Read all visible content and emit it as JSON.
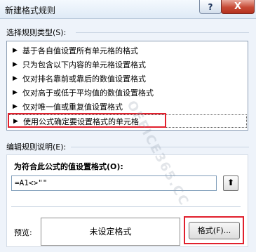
{
  "window": {
    "title": "新建格式规则",
    "help": "?",
    "close": "X"
  },
  "select_type": {
    "label": "选择规则类型(S):",
    "items": [
      {
        "label": "基于各自值设置所有单元格的格式"
      },
      {
        "label": "只为包含以下内容的单元格设置格式"
      },
      {
        "label": "仅对排名靠前或靠后的数值设置格式"
      },
      {
        "label": "仅对高于或低于平均值的数值设置格式"
      },
      {
        "label": "仅对唯一值或重复值设置格式"
      },
      {
        "label": "使用公式确定要设置格式的单元格"
      }
    ],
    "selected_index": 5,
    "bullet": "▶"
  },
  "edit": {
    "label": "编辑规则说明(E):",
    "formula_label": "为符合此公式的值设置格式(O):",
    "formula_value": "=A1<>\"\"",
    "collapse_glyph": "⬆"
  },
  "preview": {
    "label": "预览:",
    "text": "未设定格式"
  },
  "format_button": {
    "label": "格式(F)..."
  },
  "watermark": {
    "text": "OFFICE365.CC"
  },
  "colors": {
    "highlight": "#e1202d",
    "panel_bg": "#eef3fa"
  }
}
